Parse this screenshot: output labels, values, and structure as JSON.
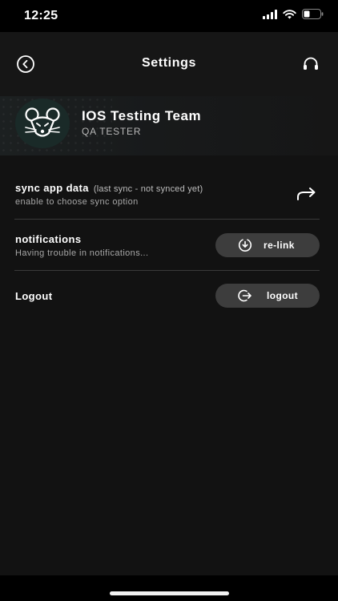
{
  "status_bar": {
    "time": "12:25",
    "icons": [
      "signal-icon",
      "wifi-icon",
      "battery-icon"
    ]
  },
  "header": {
    "title": "Settings",
    "back_icon": "back-circle-icon",
    "support_icon": "headset-icon"
  },
  "profile": {
    "name": "IOS Testing Team",
    "role": "QA TESTER",
    "avatar_icon": "mouse-logo"
  },
  "rows": {
    "sync": {
      "title": "sync app data",
      "note": "(last sync - not synced yet)",
      "subtitle": "enable to choose sync option",
      "action_icon": "forward-arrow-icon"
    },
    "notifications": {
      "title": "notifications",
      "subtitle": "Having trouble in notifications...",
      "button_label": "re-link",
      "button_icon": "download-circle-icon"
    },
    "logout": {
      "title": "Logout",
      "button_label": "logout",
      "button_icon": "logout-icon"
    }
  },
  "colors": {
    "background": "#121212",
    "pill": "#3d3d3d",
    "divider": "#3a3a3a"
  }
}
